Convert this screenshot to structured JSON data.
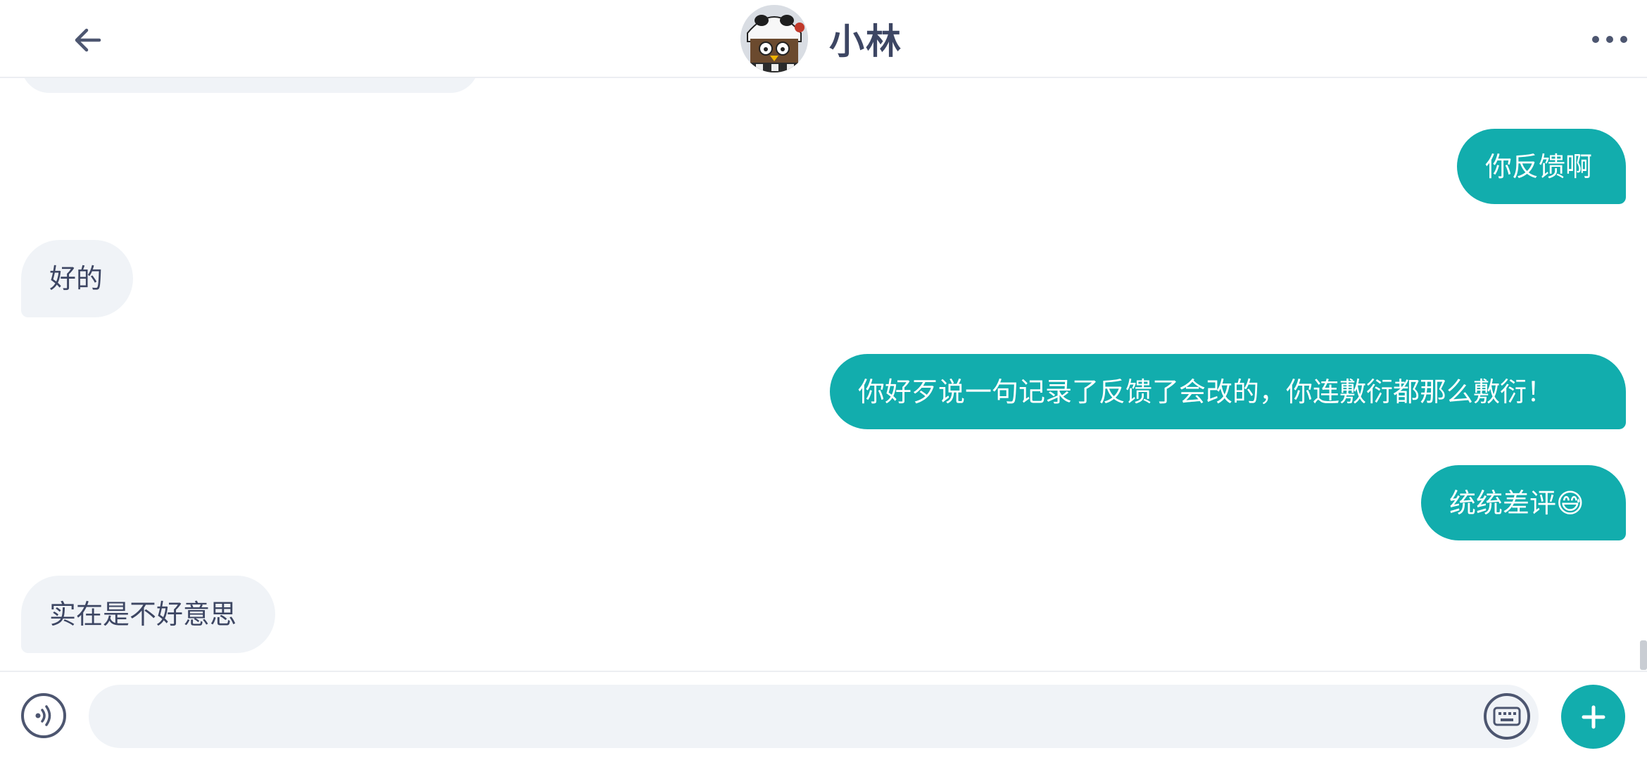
{
  "header": {
    "title": "小林",
    "back_icon": "arrow-left-icon",
    "more_icon": "more-horizontal-icon",
    "avatar": "contact-avatar"
  },
  "messages": [
    {
      "id": "m1",
      "direction": "outgoing",
      "text": "你反馈啊"
    },
    {
      "id": "m2",
      "direction": "incoming",
      "text": "好的"
    },
    {
      "id": "m3",
      "direction": "outgoing",
      "text": "你好歹说一句记录了反馈了会改的，你连敷衍都那么敷衍！"
    },
    {
      "id": "m4",
      "direction": "outgoing",
      "text": "统统差评😅"
    },
    {
      "id": "m5",
      "direction": "incoming",
      "text": "实在是不好意思"
    }
  ],
  "input": {
    "value": "",
    "voice_icon": "voice-icon",
    "keyboard_icon": "keyboard-icon",
    "plus_icon": "plus-icon"
  },
  "colors": {
    "accent": "#12adad",
    "incoming_bubble": "#f0f3f7",
    "text_dark": "#3d4663"
  }
}
